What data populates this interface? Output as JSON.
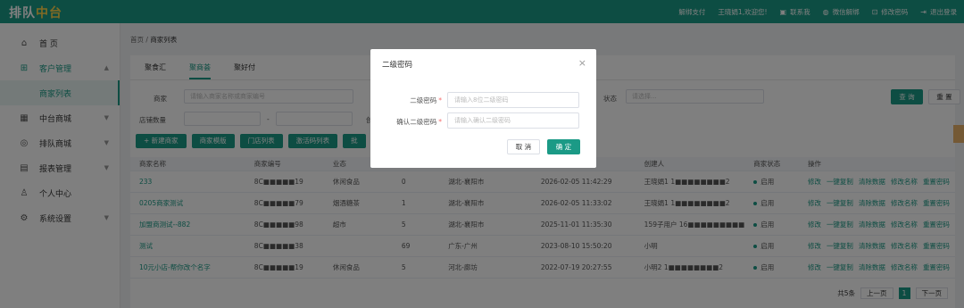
{
  "topbar": {
    "logo_a": "排队",
    "logo_b": "中台",
    "unbind_pay": "解绑支付",
    "welcome": "王晓娟1,欢迎您!",
    "contact": "联系我",
    "wechat_unbind": "微信解绑",
    "change_password": "修改密码",
    "logout": "退出登录",
    "accent": "#1b9a86"
  },
  "sidebar": {
    "home": "首 页",
    "customer_mgmt": "客户管理",
    "merchant_list": "商家列表",
    "mid_mall": "中台商城",
    "queue_mall": "排队商城",
    "reports": "报表管理",
    "personal": "个人中心",
    "settings": "系统设置"
  },
  "breadcrumb": {
    "home": "首页",
    "sep": "/",
    "current": "商家列表"
  },
  "tabs": [
    "聚食汇",
    "聚商荟",
    "聚好付"
  ],
  "filters": {
    "merchant_label": "商家",
    "merchant_placeholder": "请输入商家名称或商家编号",
    "status_label": "状态",
    "status_placeholder": "请选择...",
    "store_count_label": "店铺数量",
    "range_sep": "-",
    "created_label": "创建",
    "query": "查 询",
    "reset": "重 置"
  },
  "actions": [
    "+ 新建商家",
    "商家模版",
    "门店列表",
    "激活码列表",
    "批"
  ],
  "table": {
    "headers": [
      "商家名称",
      "商家编号",
      "业态",
      "",
      "",
      "",
      "创建人",
      "商家状态",
      "操作"
    ],
    "ops": [
      "修改",
      "一键复制",
      "清除数据",
      "修改名称",
      "重置密码"
    ],
    "rows": [
      [
        "233",
        "8C■■■■■19",
        "休闲食品",
        "0",
        "湖北-襄阳市",
        "2026-02-05 11:42:29",
        "王晓娟1 1■■■■■■■■2",
        "启用"
      ],
      [
        "0205商家测试",
        "8C■■■■■79",
        "烟酒糖茶",
        "1",
        "湖北-襄阳市",
        "2026-02-05 11:33:02",
        "王晓娟1 1■■■■■■■■2",
        "启用"
      ],
      [
        "加盟商测试--882",
        "8C■■■■■98",
        "超市",
        "5",
        "湖北-襄阳市",
        "2025-11-01 11:35:30",
        "159子用户 16■■■■■■■■■",
        "启用"
      ],
      [
        "测试",
        "8C■■■■■38",
        "",
        "69",
        "广东-广州",
        "2023-08-10 15:50:20",
        "小明",
        "启用"
      ],
      [
        "10元小店-帮你改个名字",
        "8C■■■■■19",
        "休闲食品",
        "5",
        "河北-廊坊",
        "2022-07-19 20:27:55",
        "小明2 1■■■■■■■■2",
        "启用"
      ]
    ]
  },
  "pager": {
    "total": "共5条",
    "prev": "上一页",
    "page": "1",
    "next": "下一页"
  },
  "dialog": {
    "title": "二级密码",
    "close": "×",
    "pwd_label": "二级密码",
    "pwd_placeholder": "请输入8位二级密码",
    "confirm_label": "确认二级密码",
    "confirm_placeholder": "请输入确认二级密码",
    "required": "*",
    "cancel": "取 消",
    "ok": "确 定"
  }
}
